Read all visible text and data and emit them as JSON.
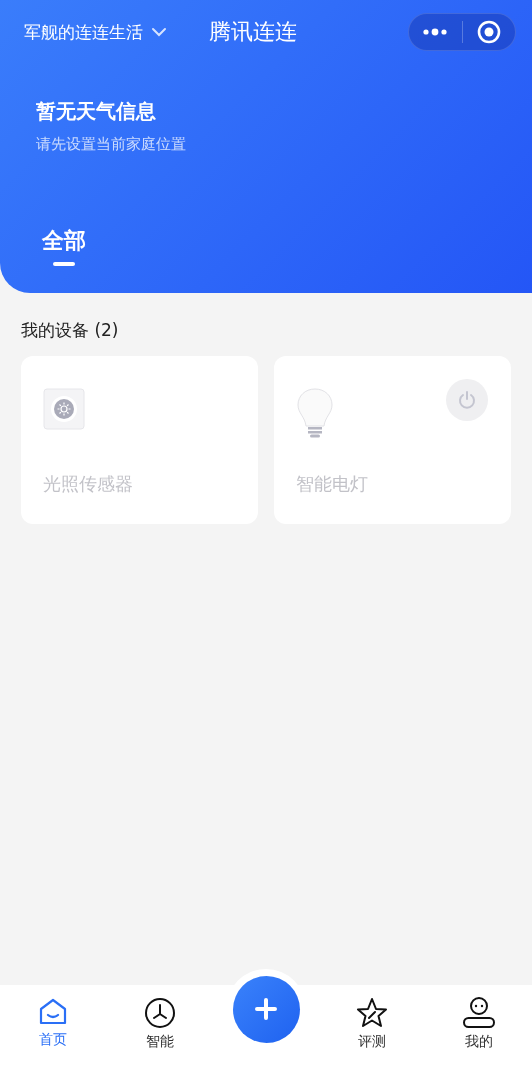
{
  "top_bar": {
    "home_name": "军舰的连连生活",
    "title": "腾讯连连"
  },
  "weather": {
    "title": "暂无天气信息",
    "subtitle": "请先设置当前家庭位置"
  },
  "tabs": [
    {
      "label": "全部",
      "selected": true
    }
  ],
  "devices_section": {
    "title": "我的设备 (2)"
  },
  "devices": [
    {
      "kind": "sensor",
      "name": "光照传感器"
    },
    {
      "kind": "lamp",
      "name": "智能电灯",
      "has_power_button": true
    }
  ],
  "nav": [
    {
      "kind": "home",
      "label": "首页",
      "selected": true
    },
    {
      "kind": "smart",
      "label": "智能",
      "selected": false
    },
    {
      "kind": "add"
    },
    {
      "kind": "review",
      "label": "评测",
      "selected": false
    },
    {
      "kind": "me",
      "label": "我的",
      "selected": false
    }
  ]
}
